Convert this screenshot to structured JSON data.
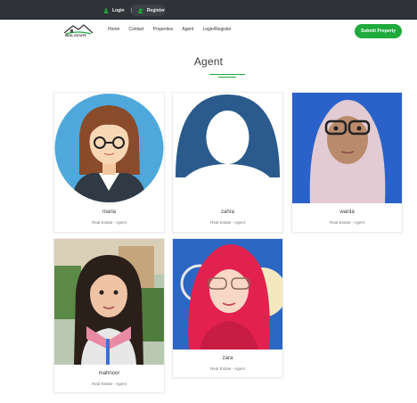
{
  "topbar": {
    "login": "Login",
    "separator": "|",
    "register": "Register"
  },
  "nav": {
    "logo_text": "REAL ESTATE",
    "items": [
      "Home",
      "Contact",
      "Properties",
      "Agent",
      "Login/Register"
    ],
    "submit_label": "Submit Property"
  },
  "page": {
    "title": "Agent"
  },
  "agents": [
    {
      "name": "maria",
      "role": "Real Estate - Agent"
    },
    {
      "name": "zahra",
      "role": "Real Estate - Agent"
    },
    {
      "name": "warda",
      "role": "Real Estate - Agent"
    },
    {
      "name": "mahnoor",
      "role": "Real Estate - Agent"
    },
    {
      "name": "zara",
      "role": "Real Estate - Agent"
    }
  ],
  "colors": {
    "topbar": "#2f3337",
    "accent_green": "#1faa3c",
    "avatar_blue": "#2a5b8c",
    "avatar_sky": "#4fa8dc"
  }
}
